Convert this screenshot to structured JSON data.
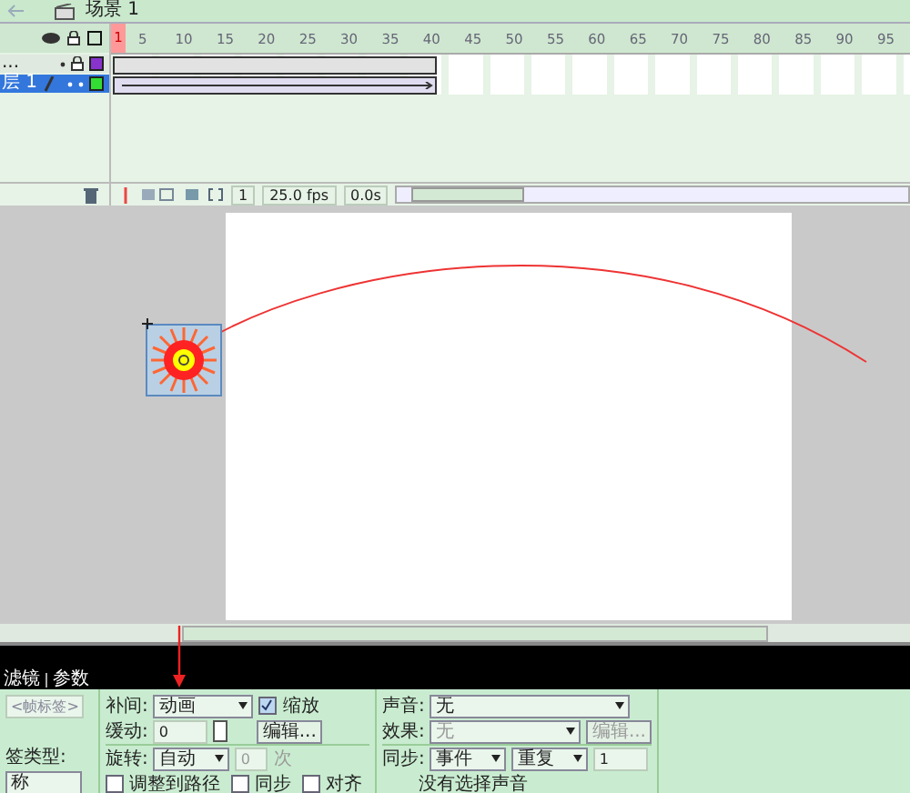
{
  "scene_tab": {
    "label": "场景 1"
  },
  "timeline": {
    "ruler": [
      "1",
      "5",
      "10",
      "15",
      "20",
      "25",
      "30",
      "35",
      "40",
      "45",
      "50",
      "55",
      "60",
      "65",
      "70",
      "75",
      "80",
      "85",
      "90",
      "95"
    ],
    "layers": [
      {
        "name": "...",
        "selected": false,
        "kind": "guide"
      },
      {
        "name": "层 1",
        "selected": true,
        "kind": "normal"
      }
    ],
    "frame": "1",
    "fps": "25.0 fps",
    "time": "0.0s"
  },
  "properties": {
    "tabs": [
      "滤镜",
      "参数"
    ],
    "frame_label": {
      "placeholder": "<帧标签>"
    },
    "label_type": "签类型:",
    "label_type_value": "称",
    "tween_label": "补间:",
    "tween": "动画",
    "scale": {
      "label": "缩放",
      "checked": true
    },
    "ease_label": "缓动:",
    "ease": "0",
    "edit": "编辑...",
    "rotate_label": "旋转:",
    "rotate": "自动",
    "times": "0",
    "times_unit": "次",
    "options": [
      {
        "label": "调整到路径",
        "checked": false
      },
      {
        "label": "同步",
        "checked": false
      },
      {
        "label": "对齐",
        "checked": false
      }
    ],
    "sound_label": "声音:",
    "sound": "无",
    "effect_label": "效果:",
    "effect": "无",
    "effect_edit": "编辑...",
    "sync_label": "同步:",
    "sync": "事件",
    "repeat": "重复",
    "repeat_count": "1",
    "no_sound": "没有选择声音"
  }
}
